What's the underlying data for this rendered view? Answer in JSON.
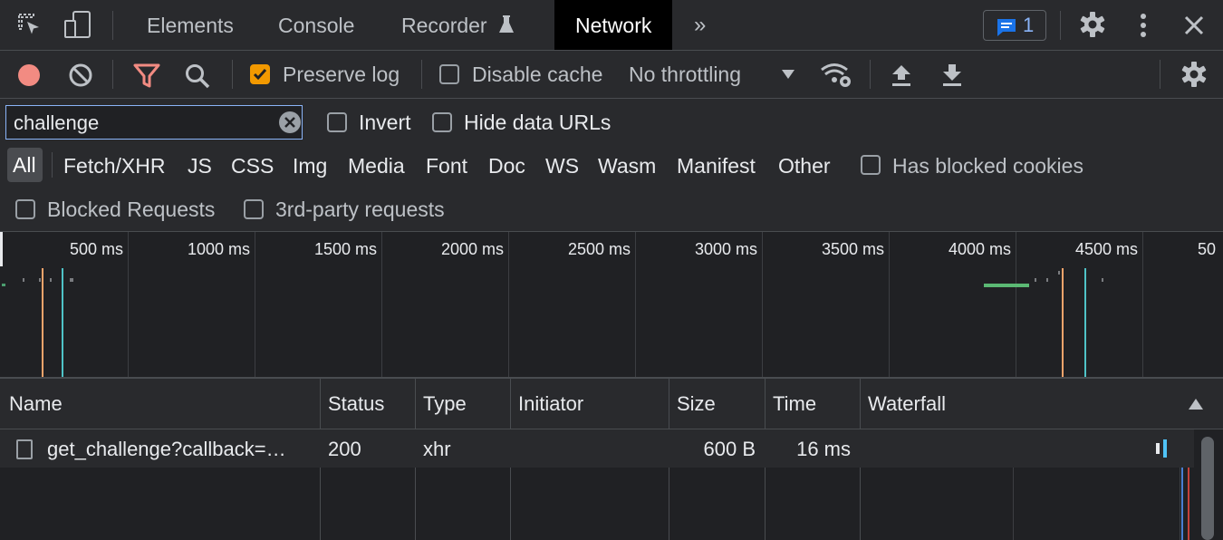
{
  "tabs": [
    {
      "label": "Elements"
    },
    {
      "label": "Console"
    },
    {
      "label": "Recorder"
    },
    {
      "label": "Network"
    }
  ],
  "messages_badge": "1",
  "toolbar": {
    "preserve_log": "Preserve log",
    "disable_cache": "Disable cache",
    "throttling": "No throttling"
  },
  "filter": {
    "value": "challenge",
    "invert": "Invert",
    "hide_data_urls": "Hide data URLs",
    "types": [
      "All",
      "Fetch/XHR",
      "JS",
      "CSS",
      "Img",
      "Media",
      "Font",
      "Doc",
      "WS",
      "Wasm",
      "Manifest",
      "Other"
    ],
    "has_blocked_cookies": "Has blocked cookies",
    "blocked_requests": "Blocked Requests",
    "third_party": "3rd-party requests"
  },
  "overview": {
    "ticks": [
      "500 ms",
      "1000 ms",
      "1500 ms",
      "2000 ms",
      "2500 ms",
      "3000 ms",
      "3500 ms",
      "4000 ms",
      "4500 ms",
      "50"
    ]
  },
  "table": {
    "headers": {
      "name": "Name",
      "status": "Status",
      "type": "Type",
      "initiator": "Initiator",
      "size": "Size",
      "time": "Time",
      "waterfall": "Waterfall"
    },
    "rows": [
      {
        "name": "get_challenge?callback=…",
        "status": "200",
        "type": "xhr",
        "initiator": "",
        "size": "600 B",
        "time": "16 ms"
      }
    ]
  },
  "colors": {
    "accent_blue": "#8ab4f8",
    "record_red": "#f28b82",
    "checkbox_orange": "#f29900",
    "dom_content_loaded": "#4fc3c7",
    "load_event": "#f6a46b"
  }
}
